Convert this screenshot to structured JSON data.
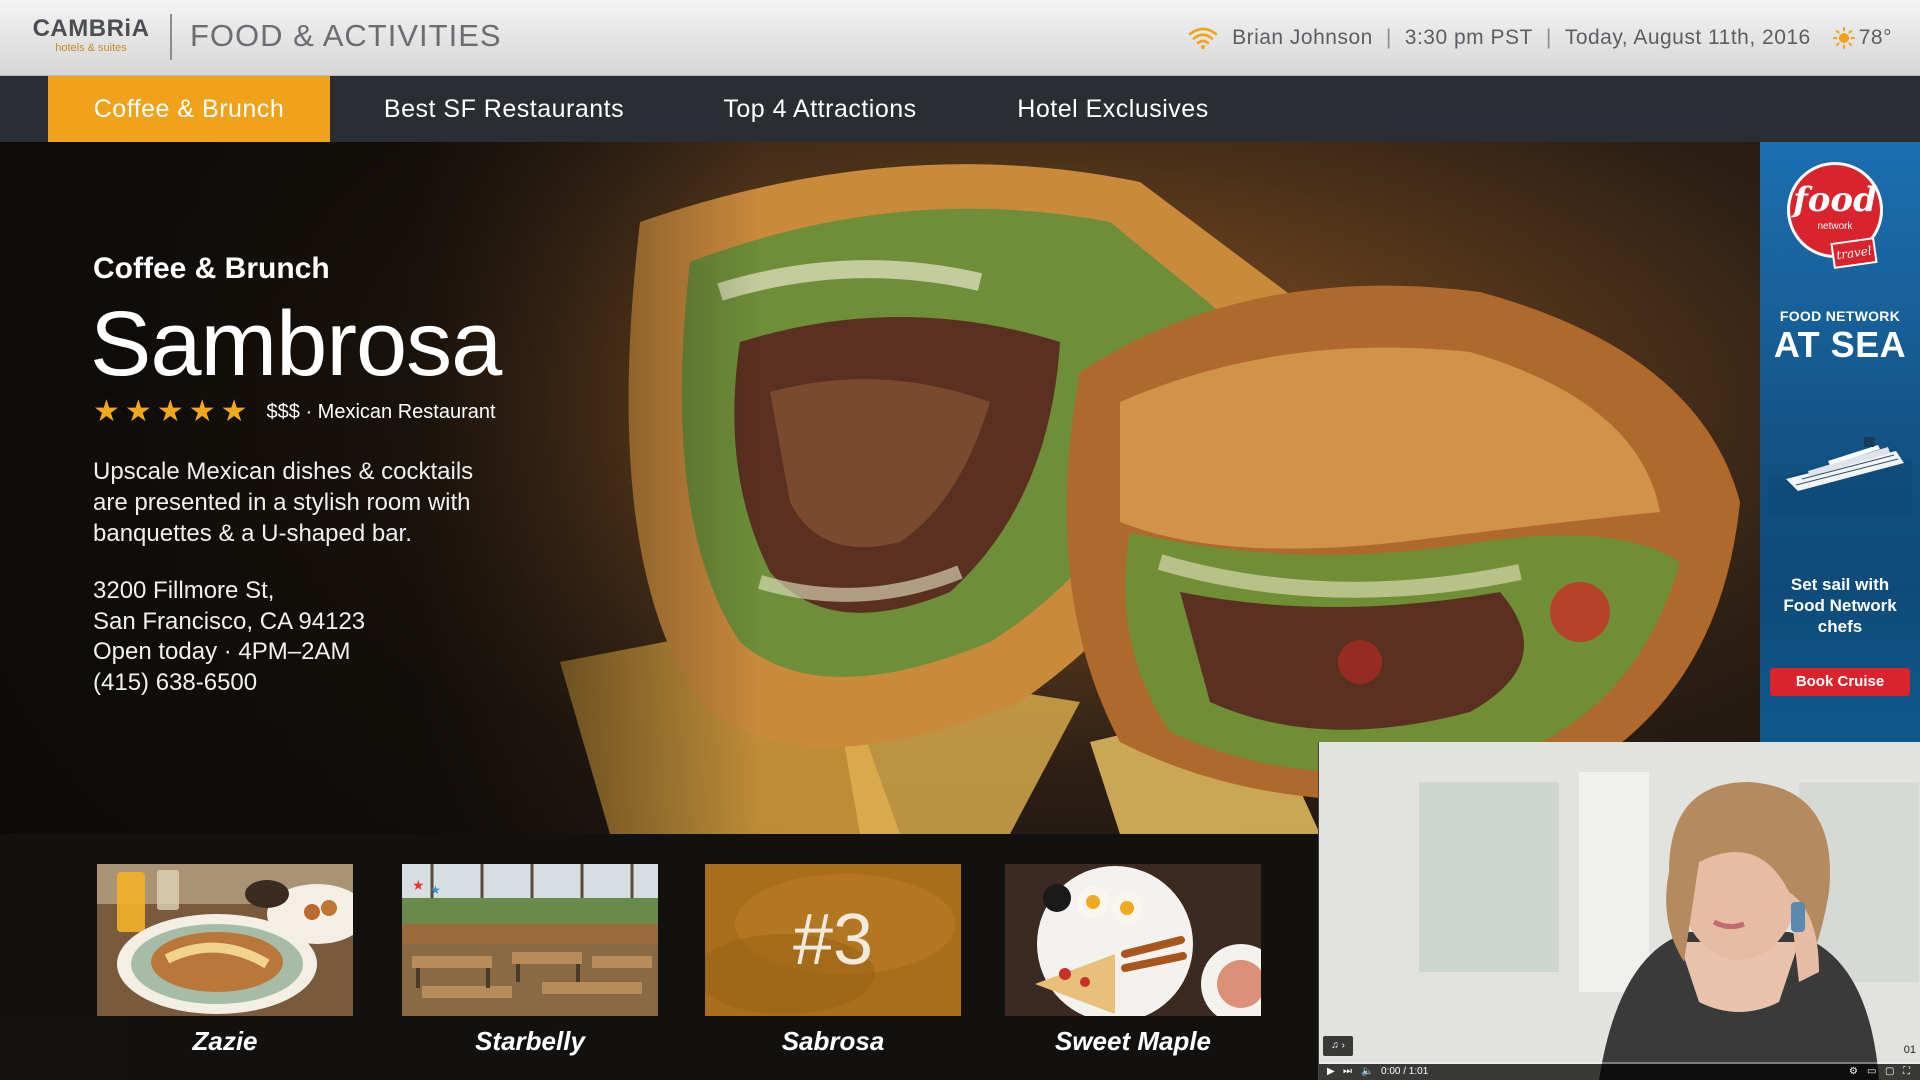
{
  "header": {
    "logo_main": "CAMBRiA",
    "logo_sub": "hotels & suites",
    "section_title": "FOOD & ACTIVITIES",
    "user": "Brian Johnson",
    "time": "3:30 pm PST",
    "date": "Today, August 11th, 2016",
    "temperature": "78°",
    "icons": {
      "wifi": "wifi-icon",
      "weather": "sun-icon"
    }
  },
  "nav": {
    "tabs": [
      {
        "label": "Coffee & Brunch",
        "active": true
      },
      {
        "label": "Best SF Restaurants",
        "active": false
      },
      {
        "label": "Top 4 Attractions",
        "active": false
      },
      {
        "label": "Hotel Exclusives",
        "active": false
      }
    ]
  },
  "feature": {
    "category": "Coffee & Brunch",
    "name": "Sambrosa",
    "rating": 5,
    "meta": "$$$ · Mexican Restaurant",
    "description_lines": [
      "Upscale Mexican dishes & cocktails",
      "are presented in a stylish room with",
      "banquettes & a U-shaped bar."
    ],
    "details_lines": [
      "3200 Fillmore St,",
      "San Francisco, CA 94123",
      "Open today · 4PM–2AM",
      "(415) 638-6500"
    ]
  },
  "carousel": {
    "items": [
      {
        "label": "Zazie",
        "overlay": ""
      },
      {
        "label": "Starbelly",
        "overlay": ""
      },
      {
        "label": "Sabrosa",
        "overlay": "#3"
      },
      {
        "label": "Sweet Maple",
        "overlay": ""
      }
    ]
  },
  "ad": {
    "logo_text": "food",
    "logo_sub": "network",
    "logo_badge": "travel",
    "headline_small": "FOOD NETWORK",
    "headline_big": "AT SEA",
    "copy_lines": [
      "Set sail with",
      "Food Network",
      "chefs"
    ],
    "button_label": "Book Cruise"
  },
  "video": {
    "chip": "♫ ›",
    "time_readout": "0:00 / 1:01",
    "corner_time": "01"
  },
  "colors": {
    "accent": "#f0a21c",
    "nav_bg": "#2a2d31",
    "ad_red": "#d9232d",
    "ad_blue": "#175f98"
  }
}
